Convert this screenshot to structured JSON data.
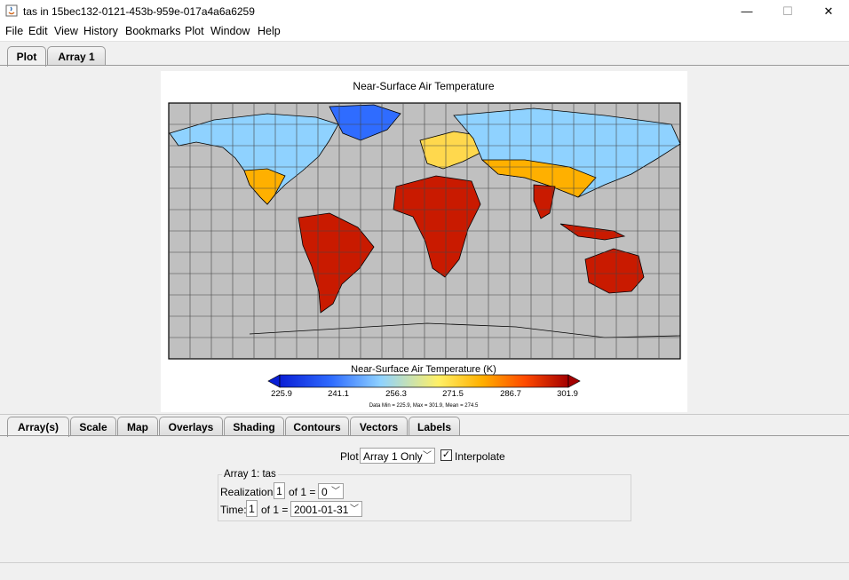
{
  "window": {
    "title": "tas in 15bec132-0121-453b-959e-017a4a6a6259",
    "minimize": "—",
    "maximize": "☐",
    "close": "✕"
  },
  "menu": [
    "File",
    "Edit",
    "View",
    "History",
    "Bookmarks",
    "Plot",
    "Window",
    "Help"
  ],
  "top_tabs": [
    "Plot",
    "Array 1"
  ],
  "plot": {
    "title": "Near-Surface Air Temperature",
    "colorbar_label": "Near-Surface Air Temperature (K)",
    "colorbar_ticks": [
      "225.9",
      "241.1",
      "256.3",
      "271.5",
      "286.7",
      "301.9"
    ],
    "colorbar_colors": [
      "#0a1fd6",
      "#2f6cff",
      "#8fd2ff",
      "#fff066",
      "#ffb000",
      "#ff4a00",
      "#a40000"
    ],
    "stats": "Data Min = 225.9, Max = 301.9, Mean = 274.5",
    "ocean_color": "#c0c0c0"
  },
  "bottom_tabs": [
    "Array(s)",
    "Scale",
    "Map",
    "Overlays",
    "Shading",
    "Contours",
    "Vectors",
    "Labels"
  ],
  "controls": {
    "plot_label": "Plot",
    "plot_select": "Array 1 Only",
    "interpolate_label": "Interpolate",
    "interpolate_checked": true,
    "group_title": "Array 1: tas",
    "realization_label": "Realization:",
    "realization_value": "1",
    "realization_of": "of 1 =",
    "realization_select": "0",
    "time_label": "Time:",
    "time_value": "1",
    "time_of": "of 1 =",
    "time_select": "2001-01-31"
  }
}
